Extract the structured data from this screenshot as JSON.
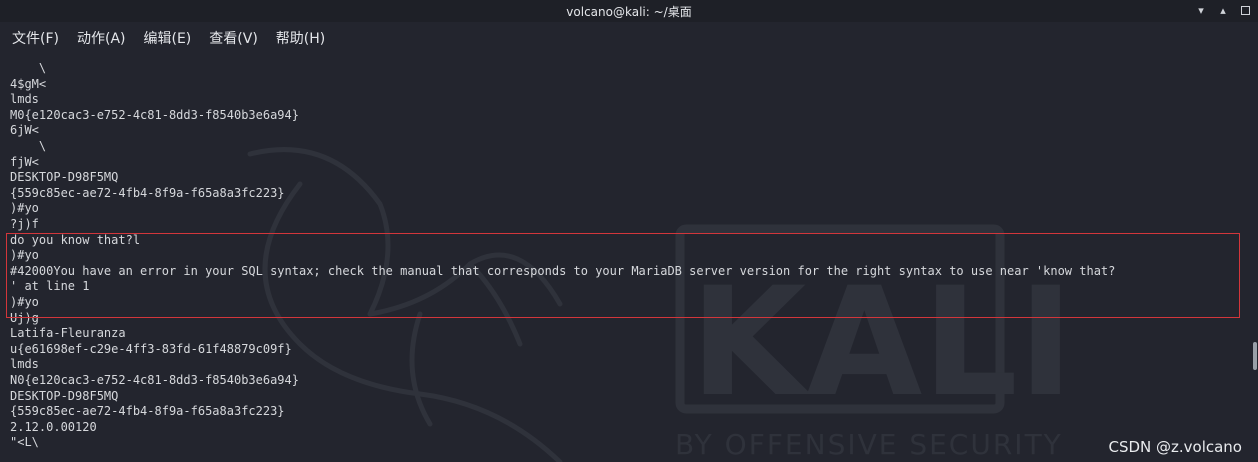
{
  "window": {
    "title": "volcano@kali: ~/桌面"
  },
  "menu": [
    "文件(F)",
    "动作(A)",
    "编辑(E)",
    "查看(V)",
    "帮助(H)"
  ],
  "terminal": {
    "lines": [
      "    \\",
      "4$gM<",
      "lmds",
      "M0{e120cac3-e752-4c81-8dd3-f8540b3e6a94}",
      "6jW<",
      "    \\",
      "fjW<",
      "DESKTOP-D98F5MQ",
      "{559c85ec-ae72-4fb4-8f9a-f65a8a3fc223}",
      ")#yo",
      "?j)f",
      "do you know that?l",
      ")#yo",
      "#42000You have an error in your SQL syntax; check the manual that corresponds to your MariaDB server version for the right syntax to use near 'know that?",
      "' at line 1",
      ")#yo",
      "Uj)g",
      "Latifa-Fleuranza",
      "u{e61698ef-c29e-4ff3-83fd-61f48879c09f}",
      "lmds",
      "N0{e120cac3-e752-4c81-8dd3-f8540b3e6a94}",
      "DESKTOP-D98F5MQ",
      "{559c85ec-ae72-4fb4-8f9a-f65a8a3fc223}",
      "2.12.0.00120",
      "\"<L\\"
    ]
  },
  "watermark": {
    "logo_text": "KALI",
    "tagline": "BY OFFENSIVE SECURITY",
    "credit": "CSDN @z.volcano"
  },
  "colors": {
    "background": "#23252e",
    "text": "#d6d8dc",
    "highlight_border": "#d2363b"
  }
}
